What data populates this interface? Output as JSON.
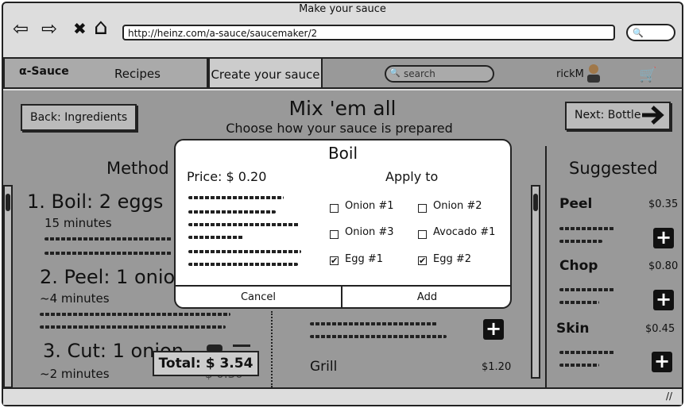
{
  "window": {
    "title": "Make your sauce"
  },
  "browser": {
    "url": "http://heinz.com/a-sauce/saucemaker/2",
    "back_glyph": "⇦",
    "forward_glyph": "⇨",
    "close_glyph": "✖",
    "home_glyph": "⌂"
  },
  "nav": {
    "logo": "α-Sauce",
    "recipes": "Recipes",
    "create": "Create your sauce",
    "search_placeholder": "search",
    "user": "rickM",
    "cart_glyph": "🛒"
  },
  "page": {
    "back_button": "Back: Ingredients",
    "next_button": "Next: Bottle",
    "heading": "Mix 'em all",
    "subheading": "Choose how your sauce is prepared"
  },
  "method": {
    "title": "Method",
    "step1_title": "1. Boil: 2 eggs",
    "step1_time": "15 minutes",
    "step2_title": "2. Peel: 1 onio",
    "step2_time": "~4 minutes",
    "step3_title": "3. Cut: 1 onion",
    "step3_time": "~2 minutes",
    "step3_price_partial": "$ 0.30"
  },
  "middle": {
    "grill_label": "Grill",
    "grill_price": "$1.20"
  },
  "total": {
    "label": "Total: $ 3.54"
  },
  "suggested": {
    "title": "Suggested",
    "items": [
      {
        "name": "Peel",
        "price": "$0.35"
      },
      {
        "name": "Chop",
        "price": "$0.80"
      },
      {
        "name": "Skin",
        "price": "$0.45"
      }
    ]
  },
  "modal": {
    "title": "Boil",
    "price": "Price: $ 0.20",
    "apply_to": "Apply to",
    "options": [
      {
        "label": "Onion #1",
        "checked": false
      },
      {
        "label": "Onion #2",
        "checked": false
      },
      {
        "label": "Onion #3",
        "checked": false
      },
      {
        "label": "Avocado #1",
        "checked": false
      },
      {
        "label": "Egg #1",
        "checked": true
      },
      {
        "label": "Egg #2",
        "checked": true
      }
    ],
    "cancel": "Cancel",
    "add": "Add"
  }
}
